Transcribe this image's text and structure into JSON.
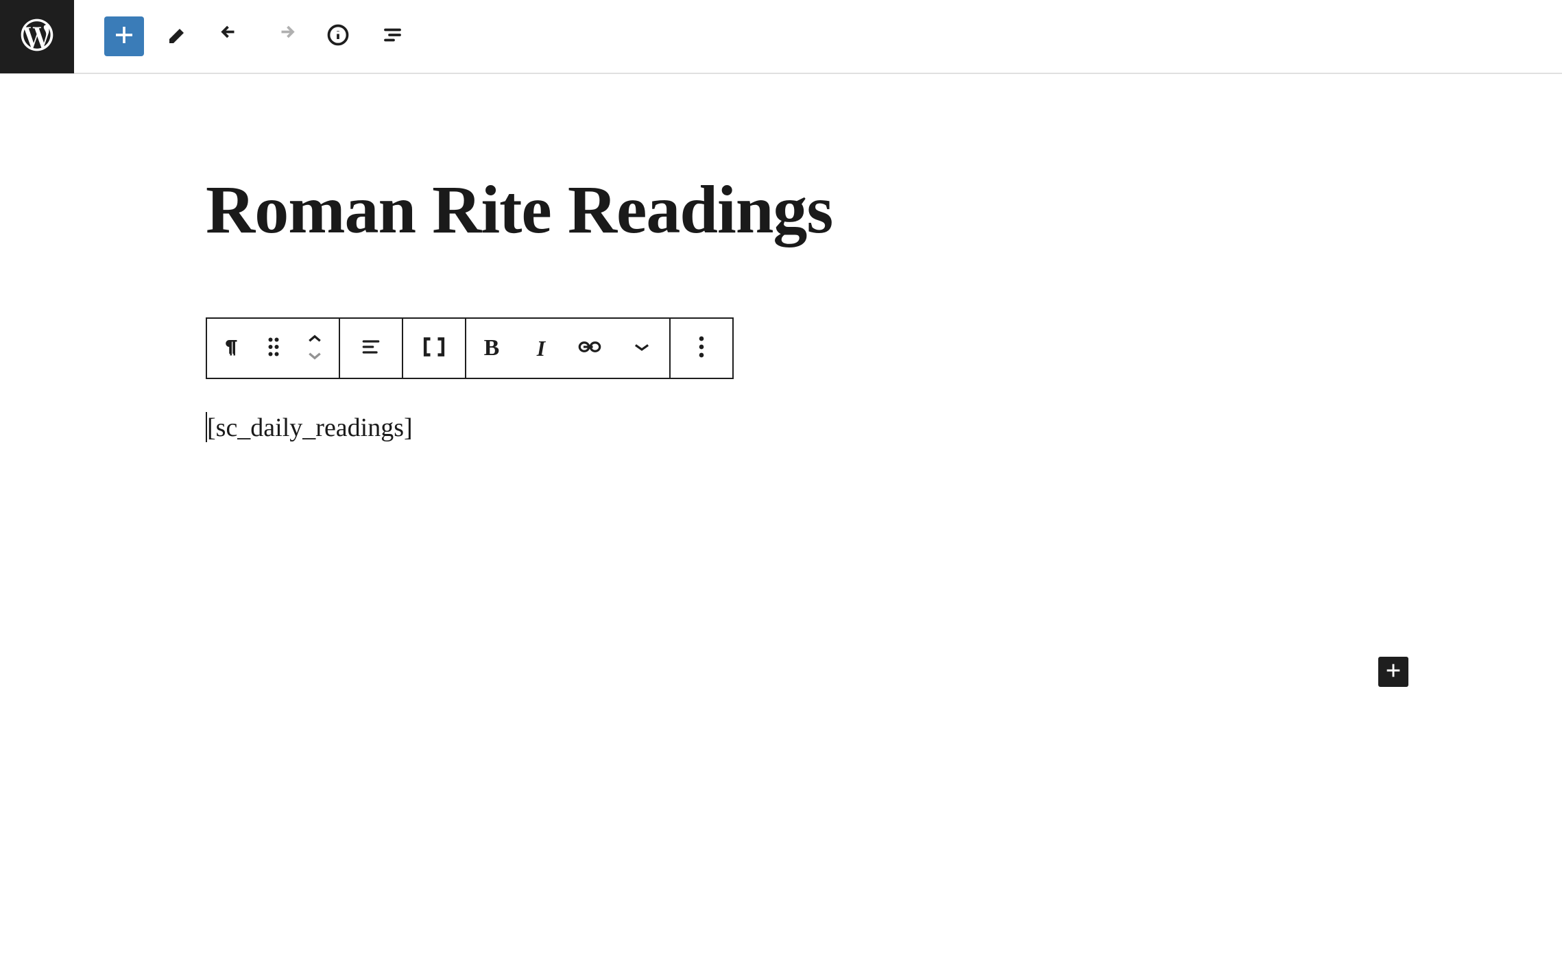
{
  "header": {
    "wp_logo_label": "WordPress"
  },
  "toolbar": {
    "add_block": "Add block",
    "tools": "Tools",
    "undo": "Undo",
    "redo": "Redo",
    "details": "Details",
    "outline": "Outline"
  },
  "post": {
    "title": "Roman Rite Readings"
  },
  "block_toolbar": {
    "paragraph": "Paragraph",
    "drag": "Drag",
    "move_up": "Move up",
    "move_down": "Move down",
    "align": "Align",
    "shortcode": "Shortcode",
    "bold": "Bold",
    "italic": "Italic",
    "link": "Link",
    "more": "More",
    "options": "Options"
  },
  "content": {
    "shortcode_text": "[sc_daily_readings]"
  },
  "inserter": {
    "add_block": "Add block"
  }
}
